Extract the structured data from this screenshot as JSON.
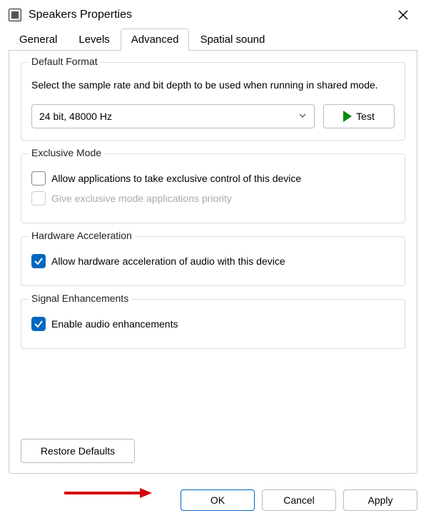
{
  "window": {
    "title": "Speakers Properties"
  },
  "tabs": {
    "general": "General",
    "levels": "Levels",
    "advanced": "Advanced",
    "spatial": "Spatial sound"
  },
  "defaultFormat": {
    "title": "Default Format",
    "desc": "Select the sample rate and bit depth to be used when running in shared mode.",
    "value": "24 bit, 48000 Hz",
    "testLabel": "Test"
  },
  "exclusiveMode": {
    "title": "Exclusive Mode",
    "opt1": "Allow applications to take exclusive control of this device",
    "opt2": "Give exclusive mode applications priority"
  },
  "hwAccel": {
    "title": "Hardware Acceleration",
    "opt": "Allow hardware acceleration of audio with this device"
  },
  "signal": {
    "title": "Signal Enhancements",
    "opt": "Enable audio enhancements"
  },
  "buttons": {
    "restore": "Restore Defaults",
    "ok": "OK",
    "cancel": "Cancel",
    "apply": "Apply"
  }
}
